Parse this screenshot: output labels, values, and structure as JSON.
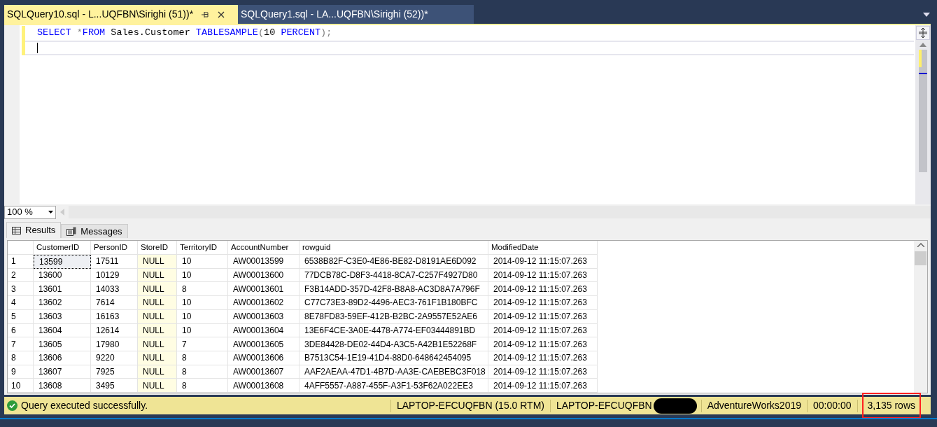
{
  "doc_tabs": [
    {
      "label": "SQLQuery10.sql - L...UQFBN\\Sirighi (51))*",
      "selected": true
    },
    {
      "label": "SQLQuery1.sql - LA...UQFBN\\Sirighi (52))*",
      "selected": false
    }
  ],
  "editor": {
    "lines": [
      {
        "current": false,
        "tokens": [
          {
            "text": "SELECT",
            "kind": "keyword"
          },
          {
            "text": " *",
            "kind": "operator"
          },
          {
            "text": "FROM",
            "kind": "keyword"
          },
          {
            "text": " Sales.Customer ",
            "kind": "plain"
          },
          {
            "text": "TABLESAMPLE",
            "kind": "keyword"
          },
          {
            "text": "(",
            "kind": "operator"
          },
          {
            "text": "10 ",
            "kind": "plain"
          },
          {
            "text": "PERCENT",
            "kind": "keyword"
          },
          {
            "text": ");",
            "kind": "operator"
          }
        ]
      },
      {
        "current": true
      }
    ]
  },
  "zoom": {
    "value": "100 %"
  },
  "result_tabs": [
    {
      "label": "Results",
      "selected": true,
      "kind": "grid"
    },
    {
      "label": "Messages",
      "selected": false,
      "kind": "messages"
    }
  ],
  "table": {
    "columns": [
      {
        "label": "CustomerID",
        "shaded": false
      },
      {
        "label": "PersonID",
        "shaded": false
      },
      {
        "label": "StoreID",
        "shaded": true
      },
      {
        "label": "TerritoryID",
        "shaded": false
      },
      {
        "label": "AccountNumber",
        "shaded": false
      },
      {
        "label": "rowguid",
        "shaded": false
      },
      {
        "label": "ModifiedDate",
        "shaded": false
      }
    ],
    "rows": [
      {
        "number": "1",
        "selected": true,
        "cells": [
          "13599",
          "17511",
          "NULL",
          "10",
          "AW00013599",
          "6538B82F-C3E0-4E86-BE82-D8191AE6D092",
          "2014-09-12 11:15:07.263"
        ]
      },
      {
        "number": "2",
        "selected": false,
        "cells": [
          "13600",
          "10129",
          "NULL",
          "10",
          "AW00013600",
          "77DCB78C-D8F3-4418-8CA7-C257F4927D80",
          "2014-09-12 11:15:07.263"
        ]
      },
      {
        "number": "3",
        "selected": false,
        "cells": [
          "13601",
          "14033",
          "NULL",
          "8",
          "AW00013601",
          "F3B14ADD-357D-42F8-B8A8-AC3D8A7A796F",
          "2014-09-12 11:15:07.263"
        ]
      },
      {
        "number": "4",
        "selected": false,
        "cells": [
          "13602",
          "7614",
          "NULL",
          "10",
          "AW00013602",
          "C77C73E3-89D2-4496-AEC3-761F1B180BFC",
          "2014-09-12 11:15:07.263"
        ]
      },
      {
        "number": "5",
        "selected": false,
        "cells": [
          "13603",
          "16163",
          "NULL",
          "10",
          "AW00013603",
          "8E78FD83-59EF-412B-B2BC-2A9557E52AE6",
          "2014-09-12 11:15:07.263"
        ]
      },
      {
        "number": "6",
        "selected": false,
        "cells": [
          "13604",
          "12614",
          "NULL",
          "10",
          "AW00013604",
          "13E6F4CE-3A0E-4478-A774-EF03444891BD",
          "2014-09-12 11:15:07.263"
        ]
      },
      {
        "number": "7",
        "selected": false,
        "cells": [
          "13605",
          "17980",
          "NULL",
          "7",
          "AW00013605",
          "3DE84428-DE02-44D4-A3C5-A42B1E52268F",
          "2014-09-12 11:15:07.263"
        ]
      },
      {
        "number": "8",
        "selected": false,
        "cells": [
          "13606",
          "9220",
          "NULL",
          "8",
          "AW00013606",
          "B7513C54-1E19-41D4-88D0-648642454095",
          "2014-09-12 11:15:07.263"
        ]
      },
      {
        "number": "9",
        "selected": false,
        "cells": [
          "13607",
          "7925",
          "NULL",
          "8",
          "AW00013607",
          "AAF2AEAA-47D1-4B7D-AA3E-CAEBEBC3F018",
          "2014-09-12 11:15:07.263"
        ]
      },
      {
        "number": "10",
        "selected": false,
        "cells": [
          "13608",
          "3495",
          "NULL",
          "8",
          "AW00013608",
          "4AFF5557-A887-455F-A3F1-53F62A022EE3",
          "2014-09-12 11:15:07.263"
        ]
      }
    ]
  },
  "status_bar": {
    "message": "Query executed successfully.",
    "segments": [
      {
        "text": "LAPTOP-EFCUQFBN (15.0 RTM)",
        "redacted": false,
        "circled": false
      },
      {
        "text": "LAPTOP-EFCUQFBN",
        "redacted": true,
        "circled": false
      },
      {
        "text": "AdventureWorks2019",
        "redacted": false,
        "circled": false
      },
      {
        "text": "00:00:00",
        "redacted": false,
        "circled": false
      },
      {
        "text": "3,135 rows",
        "redacted": false,
        "circled": true
      }
    ]
  }
}
